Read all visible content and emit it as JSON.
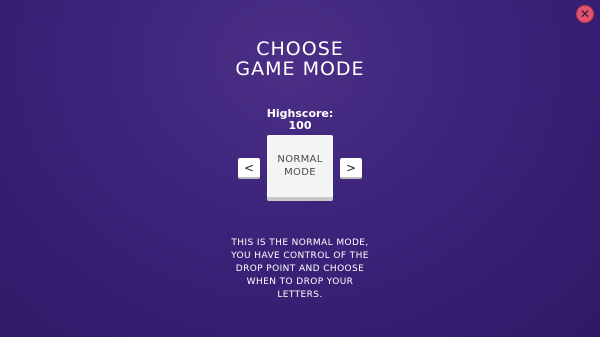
{
  "window": {
    "close_glyph": "✕"
  },
  "title": {
    "line1": "CHOOSE",
    "line2": "GAME MODE"
  },
  "highscore": {
    "label": "Highscore:",
    "value": "100"
  },
  "mode_selector": {
    "prev_glyph": "<",
    "next_glyph": ">",
    "mode_line1": "NORMAL",
    "mode_line2": "MODE"
  },
  "description": {
    "lines": [
      "THIS IS THE NORMAL MODE,",
      "YOU HAVE CONTROL OF THE",
      "DROP POINT AND CHOOSE",
      "WHEN TO DROP YOUR",
      "LETTERS."
    ]
  },
  "colors": {
    "background": "#3b237a",
    "close_button": "#e2536e",
    "card": "#f4f4f4",
    "card_text": "#4a4a4a"
  },
  "icons": {
    "close": "close-icon",
    "prev": "chevron-left-icon",
    "next": "chevron-right-icon"
  }
}
